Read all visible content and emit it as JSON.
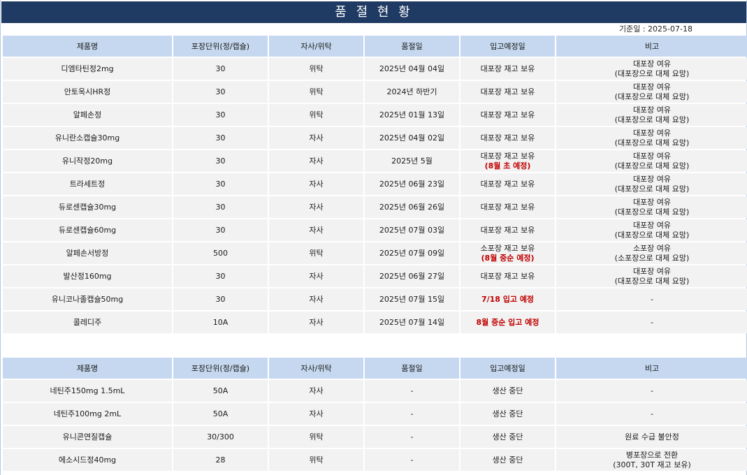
{
  "title": "품 절 현 황",
  "base_date": "기준일 : 2025-07-18",
  "headers": [
    "제품명",
    "포장단위(정/캡슐)",
    "자사/위탁",
    "품절일",
    "입고예정일",
    "비고"
  ],
  "table1": [
    {
      "name": "디엠타틴정2mg",
      "unit": "30",
      "type": "위탁",
      "date": "2025년 04월 04일",
      "eta": "대포장 재고 보유",
      "eta_note": "",
      "remark1": "대포장 여유",
      "remark2": "(대포장으로 대체 요망)"
    },
    {
      "name": "안토옥시HR정",
      "unit": "30",
      "type": "위탁",
      "date": "2024년 하반기",
      "eta": "대포장 재고 보유",
      "eta_note": "",
      "remark1": "대포장 여유",
      "remark2": "(대포장으로 대체 요망)"
    },
    {
      "name": "알페손정",
      "unit": "30",
      "type": "위탁",
      "date": "2025년 01월 13일",
      "eta": "대포장 재고 보유",
      "eta_note": "",
      "remark1": "대포장 여유",
      "remark2": "(대포장으로 대체 요망)"
    },
    {
      "name": "유니란소캡슐30mg",
      "unit": "30",
      "type": "자사",
      "date": "2025년 04월 02일",
      "eta": "대포장 재고 보유",
      "eta_note": "",
      "remark1": "대포장 여유",
      "remark2": "(대포장으로 대체 요망)"
    },
    {
      "name": "유니작정20mg",
      "unit": "30",
      "type": "자사",
      "date": "2025년 5월",
      "eta": "대포장 재고 보유",
      "eta_note": "(8월 초 예정)",
      "remark1": "대포장 여유",
      "remark2": "(대포장으로 대체 요망)"
    },
    {
      "name": "트라세트정",
      "unit": "30",
      "type": "자사",
      "date": "2025년 06월 23일",
      "eta": "대포장 재고 보유",
      "eta_note": "",
      "remark1": "대포장 여유",
      "remark2": "(대포장으로 대체 요망)"
    },
    {
      "name": "듀로센캡슐30mg",
      "unit": "30",
      "type": "자사",
      "date": "2025년 06월 26일",
      "eta": "대포장 재고 보유",
      "eta_note": "",
      "remark1": "대포장 여유",
      "remark2": "(대포장으로 대체 요망)"
    },
    {
      "name": "듀로센캡슐60mg",
      "unit": "30",
      "type": "자사",
      "date": "2025년 07월 03일",
      "eta": "대포장 재고 보유",
      "eta_note": "",
      "remark1": "대포장 여유",
      "remark2": "(대포장으로 대체 요망)"
    },
    {
      "name": "알페손서방정",
      "unit": "500",
      "type": "위탁",
      "date": "2025년 07월 09일",
      "eta": "소포장 재고 보유",
      "eta_note": "(8월 중순 예정)",
      "remark1": "소포장 여유",
      "remark2": "(소포장으로 대체 요망)"
    },
    {
      "name": "발산정160mg",
      "unit": "30",
      "type": "자사",
      "date": "2025년 06월 27일",
      "eta": "대포장 재고 보유",
      "eta_note": "",
      "remark1": "대포장 여유",
      "remark2": "(대포장으로 대체 요망)"
    },
    {
      "name": "유니코나졸캡슐50mg",
      "unit": "30",
      "type": "자사",
      "date": "2025년 07월 15일",
      "eta": "",
      "eta_note": "7/18 입고 예정",
      "remark1": "-",
      "remark2": ""
    },
    {
      "name": "콜레디주",
      "unit": "10A",
      "type": "자사",
      "date": "2025년 07월 14일",
      "eta": "",
      "eta_note": "8월 중순 입고 예정",
      "remark1": "-",
      "remark2": ""
    }
  ],
  "table2": [
    {
      "name": "네틴주150mg 1.5mL",
      "unit": "50A",
      "type": "자사",
      "date": "-",
      "eta": "생산 중단",
      "remark1": "-",
      "remark2": ""
    },
    {
      "name": "네틴주100mg 2mL",
      "unit": "50A",
      "type": "자사",
      "date": "-",
      "eta": "생산 중단",
      "remark1": "-",
      "remark2": ""
    },
    {
      "name": "유니콘연질캡슐",
      "unit": "30/300",
      "type": "위탁",
      "date": "-",
      "eta": "생산 중단",
      "remark1": "원료 수급 불안정",
      "remark2": ""
    },
    {
      "name": "에소시드정40mg",
      "unit": "28",
      "type": "위탁",
      "date": "-",
      "eta": "생산 중단",
      "remark1": "병포장으로 전환",
      "remark2": "(300T, 30T 재고 보유)"
    }
  ],
  "colors": {
    "title_bg": "#1f3a63",
    "header_bg": "#c5d8ef",
    "row_bg": "#f2f2f2",
    "alert_text": "#c00000"
  }
}
